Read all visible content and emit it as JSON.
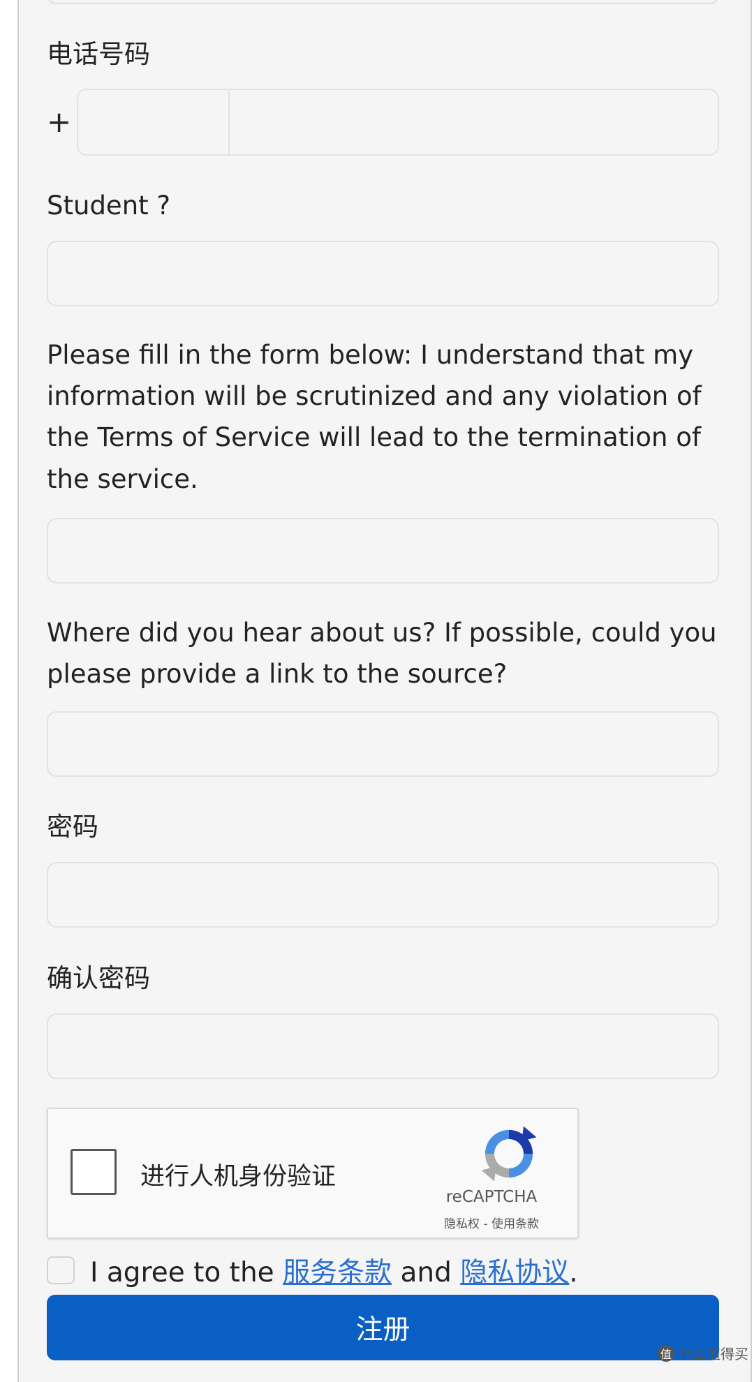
{
  "form": {
    "phone": {
      "label": "电话号码",
      "prefix": "+"
    },
    "student": {
      "label": "Student ?"
    },
    "scrutiny": {
      "label": "Please fill in the form below: I understand that my information will be scrutinized and any violation of the Terms of Service will lead to the termination of the service."
    },
    "source": {
      "label": "Where did you hear about us? If possible, could you please provide a link to the source?"
    },
    "password": {
      "label": "密码"
    },
    "confirm_password": {
      "label": "确认密码"
    }
  },
  "captcha": {
    "checkbox_label": "进行人机身份验证",
    "brand": "reCAPTCHA",
    "privacy": "隐私权",
    "separator": " - ",
    "terms": "使用条款"
  },
  "agree": {
    "prefix": "I agree to the ",
    "tos_link": "服务条款",
    "middle": " and ",
    "privacy_link": "隐私协议",
    "suffix": "."
  },
  "submit_label": "注册",
  "watermark": {
    "icon": "值",
    "text": "什么值得买"
  },
  "colors": {
    "primary": "#0a5fc4",
    "link": "#2b6fd0",
    "background": "#f5f5f5"
  }
}
